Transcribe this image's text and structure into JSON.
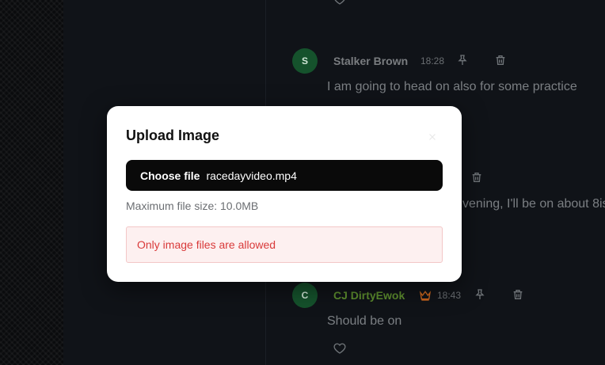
{
  "messages": [
    {
      "avatar_initial": "S",
      "author": "Stalker Brown",
      "time": "18:28",
      "text": "I am going to head on also for some practice"
    },
    {
      "partial_text": "vening, I'll be on about 8is"
    },
    {
      "avatar_initial": "C",
      "author": "CJ DirtyEwok",
      "role_icon": "crown-icon",
      "time": "18:43",
      "text": "Should be on"
    }
  ],
  "modal": {
    "title": "Upload Image",
    "choose_label": "Choose file",
    "file_name": "racedayvideo.mp4",
    "hint": "Maximum file size: 10.0MB",
    "error": "Only image files are allowed"
  },
  "colors": {
    "background": "#0d0f12",
    "avatar": "#15522c",
    "admin_name": "#5d8e2e",
    "crown": "#d2691e",
    "error_text": "#d93a3a",
    "error_bg": "#fdf0f0"
  }
}
